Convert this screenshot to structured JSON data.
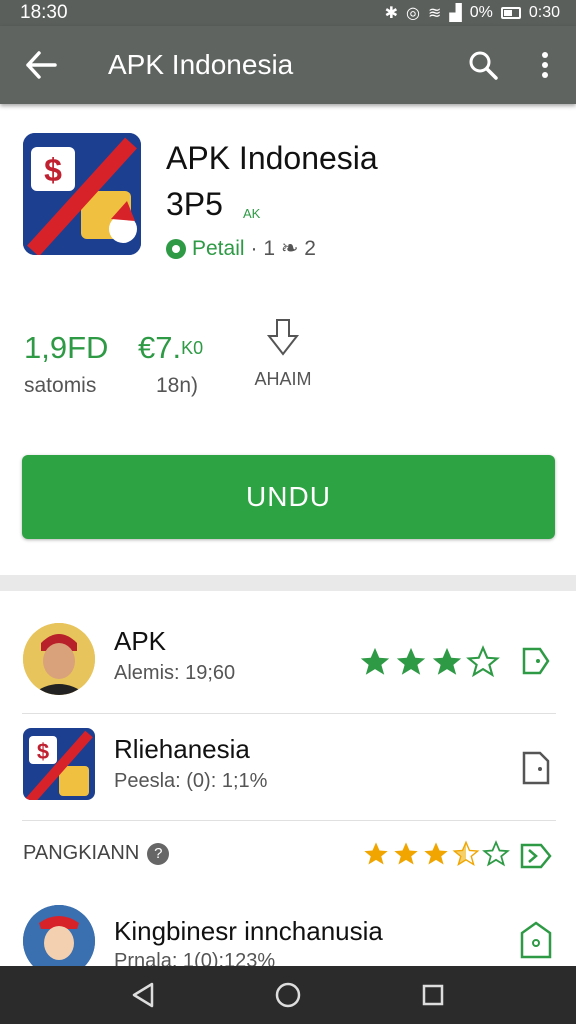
{
  "status_bar": {
    "time": "18:30",
    "battery_text": "0%",
    "clock_right": "0:30"
  },
  "app_bar": {
    "title": "APK Indonesia"
  },
  "app": {
    "name_line1": "APK Indonesia",
    "name_line2": "3P5",
    "badge": "AK",
    "developer": "Petail",
    "developer_extra": "· 1 ❧ 2"
  },
  "stats": [
    {
      "value": "1,9FD",
      "label": "satomis"
    },
    {
      "value": "€7.",
      "suffix": "K0",
      "label": "18n)"
    }
  ],
  "install": {
    "label": "AHAIM"
  },
  "download_button": {
    "label": "UNDU"
  },
  "list": [
    {
      "title": "APK",
      "subtitle": "Alemis: 19;60",
      "rating": 3.0
    },
    {
      "title": "Rliehanesia",
      "subtitle": "Peesla: (0): 1;1%"
    },
    {
      "section": "PANGKIANN"
    },
    {
      "title": "Kingbinesr innchanusia",
      "subtitle": "Prnala: 1(0):123%",
      "rating": 3.5
    }
  ],
  "colors": {
    "accent_green": "#2ea343",
    "star_green": "#2e9a45",
    "star_gold": "#f0a500",
    "app_bar": "#5f6460"
  }
}
